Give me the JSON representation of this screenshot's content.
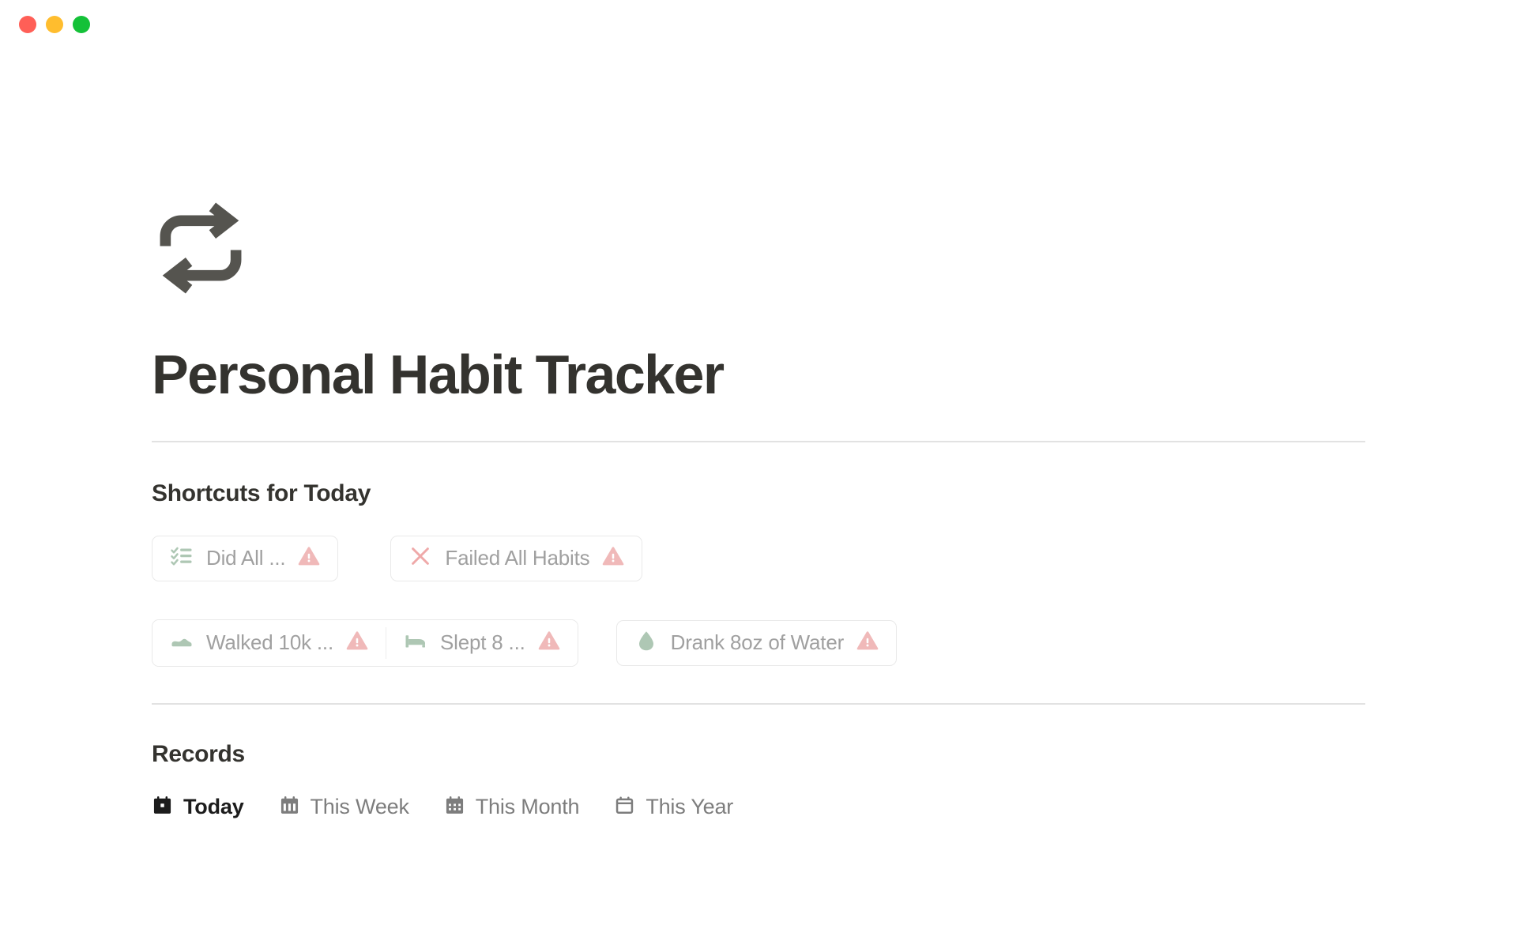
{
  "window": {
    "traffic_lights": [
      {
        "name": "close",
        "color": "#ff5f57"
      },
      {
        "name": "minimize",
        "color": "#ffbd2e"
      },
      {
        "name": "maximize",
        "color": "#14c138"
      }
    ]
  },
  "header": {
    "icon": "repeat-icon",
    "title": "Personal Habit Tracker"
  },
  "shortcuts": {
    "heading": "Shortcuts for Today",
    "row1": [
      {
        "icon": "checklist-icon",
        "label": "Did All ...",
        "badge": "warning-triangle-icon"
      },
      {
        "icon": "close-x-icon",
        "label": "Failed All Habits",
        "badge": "warning-triangle-icon"
      }
    ],
    "row2_group": [
      {
        "icon": "shoe-icon",
        "label": "Walked 10k ...",
        "badge": "warning-triangle-icon"
      },
      {
        "icon": "bed-icon",
        "label": "Slept 8 ...",
        "badge": "warning-triangle-icon"
      }
    ],
    "row2_single": [
      {
        "icon": "water-drop-icon",
        "label": "Drank 8oz of Water",
        "badge": "warning-triangle-icon"
      }
    ]
  },
  "records": {
    "heading": "Records",
    "tabs": [
      {
        "label": "Today",
        "icon": "calendar-day-icon",
        "active": true
      },
      {
        "label": "This Week",
        "icon": "calendar-week-icon",
        "active": false
      },
      {
        "label": "This Month",
        "icon": "calendar-month-icon",
        "active": false
      },
      {
        "label": "This Year",
        "icon": "calendar-year-icon",
        "active": false
      }
    ]
  },
  "colors": {
    "title": "#34332f",
    "icon_dark": "#55544f",
    "label_muted": "#a0a0a0",
    "sage": "#aec7b4",
    "warning_pink": "#f0b9b9",
    "x_red": "#efa9a9",
    "divider": "#e2e2e2",
    "border": "#e9e9e9",
    "tab_inactive": "#7d7d7d",
    "tab_active": "#1c1c1c"
  }
}
